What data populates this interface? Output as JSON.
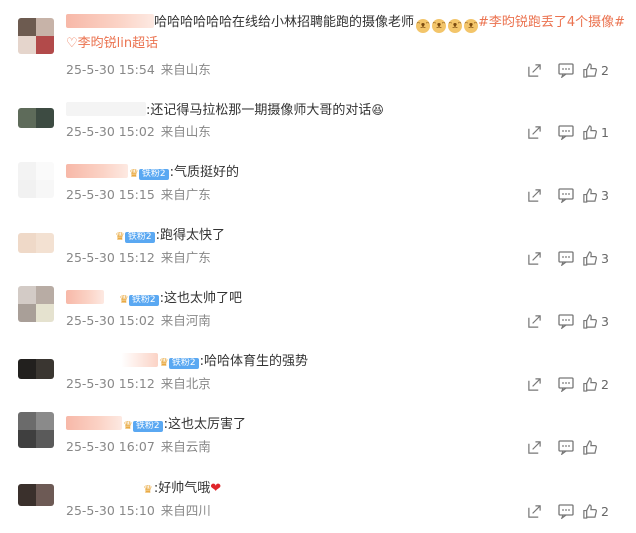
{
  "colors": {
    "accent": "#eb7350",
    "meta": "#888888",
    "fan_badge": "#5aa8f2"
  },
  "comments": [
    {
      "text": "哈哈哈哈哈哈在线给小林招聘能跑的摄像老师",
      "topic1": "#李昀锐跑丢了4个摄像#",
      "topic2": "李昀锐lin超话",
      "date": "25-5-30 15:54",
      "location": "来自山东",
      "likes": "2",
      "icons": [
        "share-icon",
        "comment-icon",
        "like-icon"
      ]
    },
    {
      "text": ":还记得马拉松那一期摄像师大哥的对话",
      "date": "25-5-30 15:02",
      "location": "来自山东",
      "likes": "1"
    },
    {
      "badge": "铁粉2",
      "text": ":气质挺好的",
      "date": "25-5-30 15:15",
      "location": "来自广东",
      "likes": "3"
    },
    {
      "badge": "铁粉2",
      "text": ":跑得太快了",
      "date": "25-5-30 15:12",
      "location": "来自广东",
      "likes": "3"
    },
    {
      "badge": "铁粉2",
      "text": ":这也太帅了吧",
      "date": "25-5-30 15:02",
      "location": "来自河南",
      "likes": "3"
    },
    {
      "badge": "铁粉2",
      "text": ":哈哈体育生的强势",
      "date": "25-5-30 15:12",
      "location": "来自北京",
      "likes": "2"
    },
    {
      "badge": "铁粉2",
      "text": ":这也太厉害了",
      "date": "25-5-30 16:07",
      "location": "来自云南",
      "likes": ""
    },
    {
      "text": ":好帅气哦",
      "date": "25-5-30 15:10",
      "location": "来自四川",
      "likes": "2"
    }
  ]
}
